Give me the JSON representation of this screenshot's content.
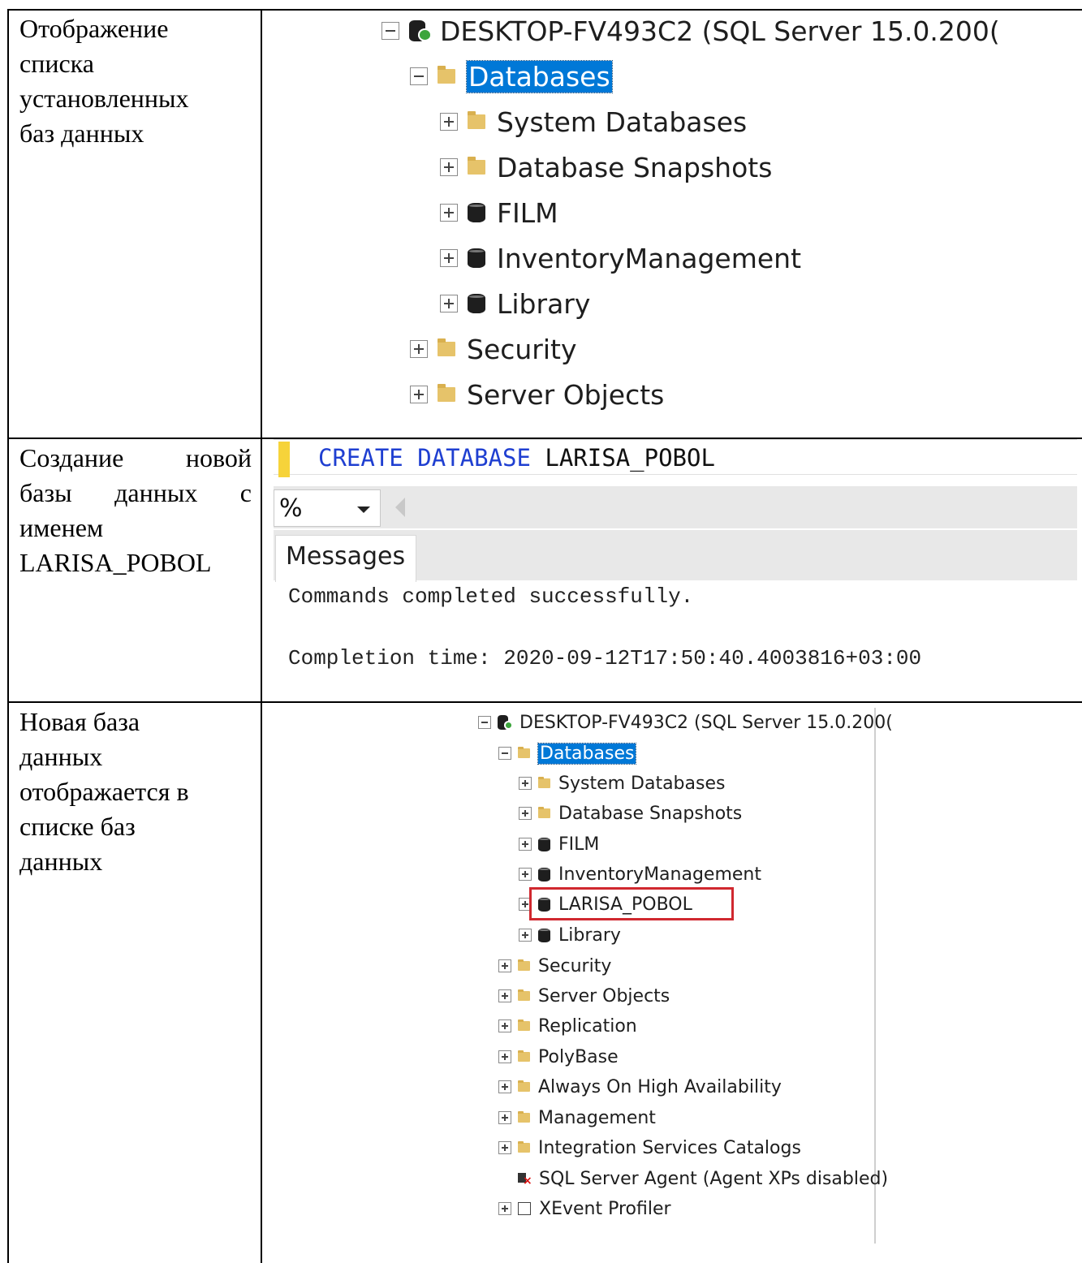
{
  "rows": [
    {
      "description": [
        "Отображение",
        "списка",
        "установленных",
        "баз данных"
      ],
      "tree": {
        "server": "DESKTOP-FV493C2 (SQL Server 15.0.200(",
        "databases": "Databases",
        "children": [
          "System Databases",
          "Database Snapshots",
          "FILM",
          "InventoryManagement",
          "Library"
        ],
        "siblings": [
          "Security",
          "Server Objects"
        ]
      }
    },
    {
      "description": [
        "Создание новой",
        "базы данных с",
        "именем",
        "LARISA_POBOL"
      ],
      "sql": {
        "kw1": "CREATE",
        "kw2": "DATABASE",
        "name": "LARISA_POBOL",
        "zoom": "%",
        "tab": "Messages",
        "message1": "Commands completed successfully.",
        "message2": "Completion time: 2020-09-12T17:50:40.4003816+03:00"
      }
    },
    {
      "description": [
        "Новая база",
        "данных",
        "отображается в",
        "списке баз",
        "данных"
      ],
      "tree": {
        "server": "DESKTOP-FV493C2 (SQL Server 15.0.200(",
        "databases": "Databases",
        "children": [
          "System Databases",
          "Database Snapshots",
          "FILM",
          "InventoryManagement",
          "LARISA_POBOL",
          "Library"
        ],
        "siblings": [
          "Security",
          "Server Objects",
          "Replication",
          "PolyBase",
          "Always On High Availability",
          "Management",
          "Integration Services Catalogs"
        ],
        "agent": "SQL Server Agent (Agent XPs disabled)",
        "xevent": "XEvent Profiler"
      }
    }
  ],
  "colors": {
    "selection": "#0078d7",
    "highlight_box": "#d0282f",
    "sql_keyword": "#1f3fd1",
    "folder": "#e6c36a",
    "server_status": "#3ca53c"
  }
}
